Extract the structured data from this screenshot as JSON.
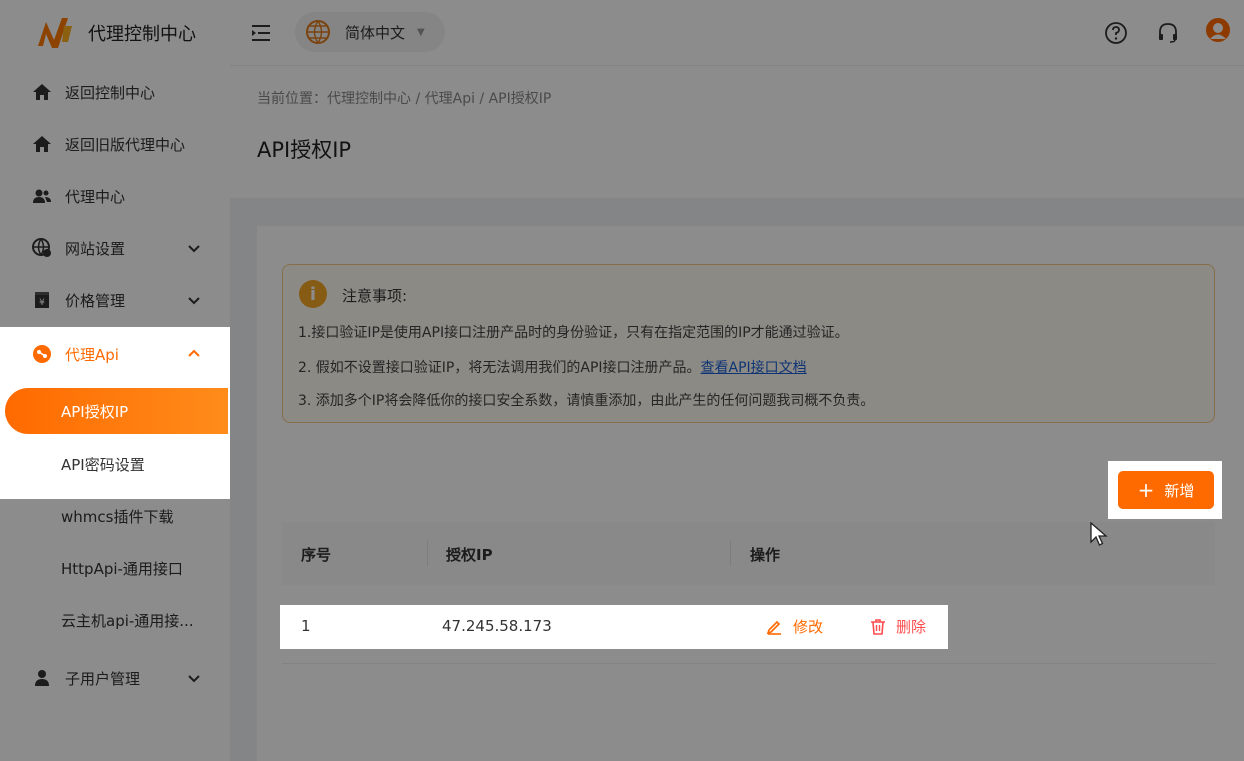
{
  "app": {
    "logo_text": "代理控制中心"
  },
  "header": {
    "language": "简体中文",
    "language_caret": "▼"
  },
  "sidebar": {
    "items": [
      {
        "label": "返回控制中心",
        "icon": "home-icon"
      },
      {
        "label": "返回旧版代理中心",
        "icon": "home-icon"
      },
      {
        "label": "代理中心",
        "icon": "users-icon"
      },
      {
        "label": "网站设置",
        "icon": "website-settings-icon"
      },
      {
        "label": "价格管理",
        "icon": "price-icon"
      },
      {
        "label": "代理Api",
        "icon": "api-icon"
      },
      {
        "label": "子用户管理",
        "icon": "user-icon"
      }
    ],
    "sub_items": [
      {
        "label": "API授权IP"
      },
      {
        "label": "API密码设置"
      },
      {
        "label": "whmcs插件下载"
      },
      {
        "label": "HttpApi-通用接口"
      },
      {
        "label": "云主机api-通用接..."
      }
    ]
  },
  "breadcrumb": "当前位置：代理控制中心 / 代理Api / API授权IP",
  "page_title": "API授权IP",
  "notice": {
    "icon_glyph": "i",
    "title": "注意事项:",
    "line1": "1.接口验证IP是使用API接口注册产品时的身份验证，只有在指定范围的IP才能通过验证。",
    "line2_prefix": "2. 假如不设置接口验证IP，将无法调用我们的API接口注册产品。",
    "line2_link": "查看API接口文档",
    "line3": "3. 添加多个IP将会降低你的接口安全系数，请慎重添加，由此产生的任何问题我司概不负责。"
  },
  "add_button": {
    "plus": "+",
    "label": "新增"
  },
  "table": {
    "columns": [
      "序号",
      "授权IP",
      "操作"
    ],
    "rows": [
      {
        "index": "1",
        "ip": "47.245.58.173",
        "edit_label": "修改",
        "delete_label": "删除"
      }
    ]
  },
  "colors": {
    "accent": "#ff6a00",
    "danger": "#ff4d4f",
    "link": "#1b5fd6",
    "notice_border": "#f5c98a"
  }
}
